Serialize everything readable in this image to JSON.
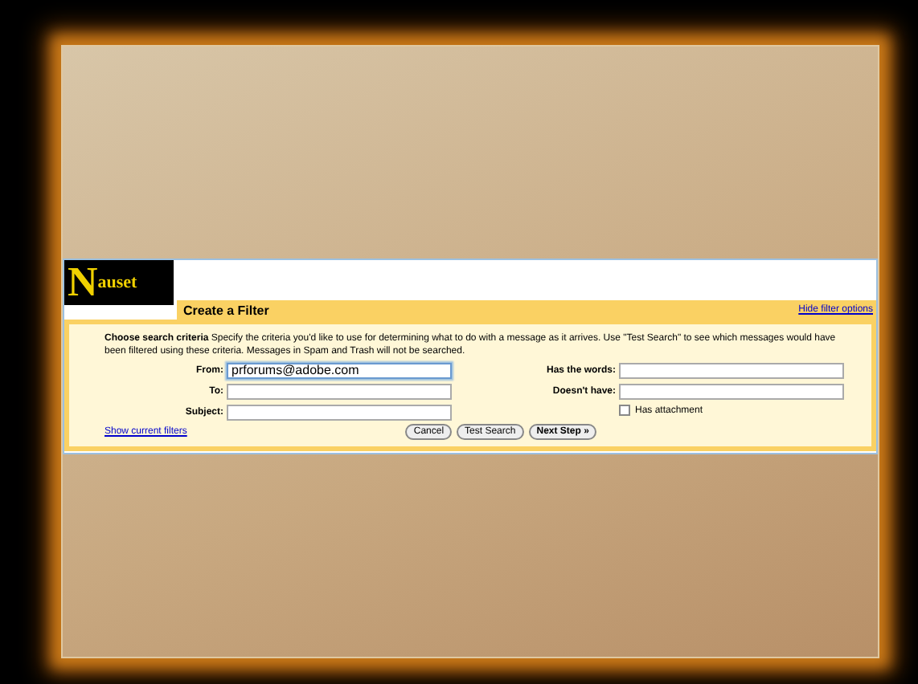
{
  "logo": {
    "initial": "N",
    "rest": "auset"
  },
  "filter": {
    "title": "Create a Filter",
    "hide_link": "Hide filter options",
    "description": "**Choose search criteria** Specify the criteria you'd like to use for determining what to do with a message as it arrives. Use \"Test Search\" to see which messages would have been filtered using these criteria. Messages in Spam and Trash will not be searched.",
    "left_fields": [
      {
        "label": "From:",
        "value": "prforums@adobe.com",
        "focused": true
      },
      {
        "label": "To:",
        "focused": false
      },
      {
        "label": "Subject:",
        "focused": false
      }
    ],
    "right_fields": [
      {
        "label": "Has the words:",
        "focused": false
      },
      {
        "label": "Doesn't have:",
        "focused": false
      }
    ],
    "attachment": {
      "label": "Has attachment",
      "checked": false
    },
    "show_link": "Show current filters",
    "buttons": [
      "Cancel",
      "Test Search",
      "Next Step »"
    ]
  }
}
